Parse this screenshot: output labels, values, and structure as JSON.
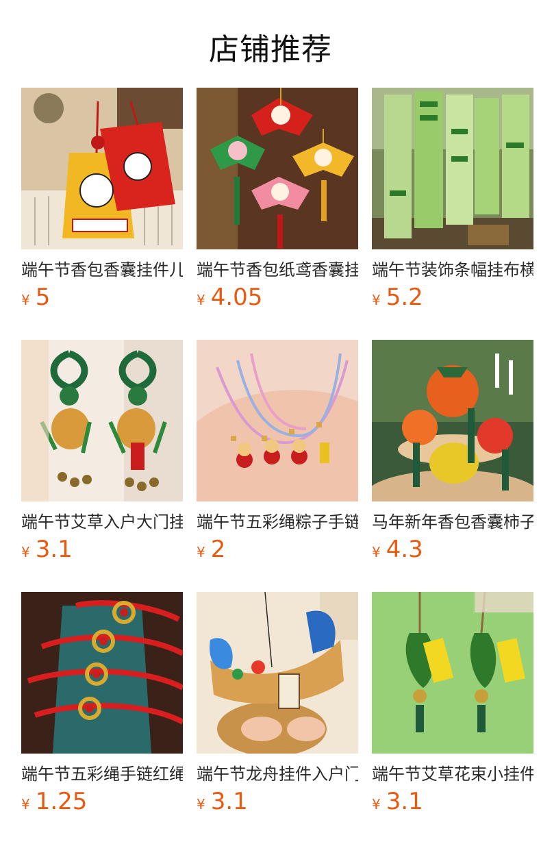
{
  "header": {
    "title": "店铺推荐"
  },
  "products": [
    {
      "name": "端午节香包香囊挂件儿童",
      "currency": "¥",
      "price": "5",
      "image": "yellow-red-charm-sachets"
    },
    {
      "name": "端午节香包纸鸢香囊挂件",
      "currency": "¥",
      "price": "4.05",
      "image": "kite-shaped-sachets"
    },
    {
      "name": "端午节装饰条幅挂布横幅",
      "currency": "¥",
      "price": "5.2",
      "image": "green-hanging-banners"
    },
    {
      "name": "端午节艾草入户大门挂件",
      "currency": "¥",
      "price": "3.1",
      "image": "mugwort-gourd-door-hangings"
    },
    {
      "name": "端午节五彩绳粽子手链儿",
      "currency": "¥",
      "price": "2",
      "image": "zongzi-charm-bracelets"
    },
    {
      "name": "马年新年香包香囊柿子挂",
      "currency": "¥",
      "price": "4.3",
      "image": "persimmon-sachets"
    },
    {
      "name": "端午节五彩绳手链红绳儿",
      "currency": "¥",
      "price": "1.25",
      "image": "red-string-bracelets"
    },
    {
      "name": "端午节龙舟挂件入户门",
      "currency": "¥",
      "price": "3.1",
      "image": "dragon-boat-hanging"
    },
    {
      "name": "端午节艾草花束小挂件",
      "currency": "¥",
      "price": "3.1",
      "image": "mugwort-bundle-bells"
    }
  ]
}
